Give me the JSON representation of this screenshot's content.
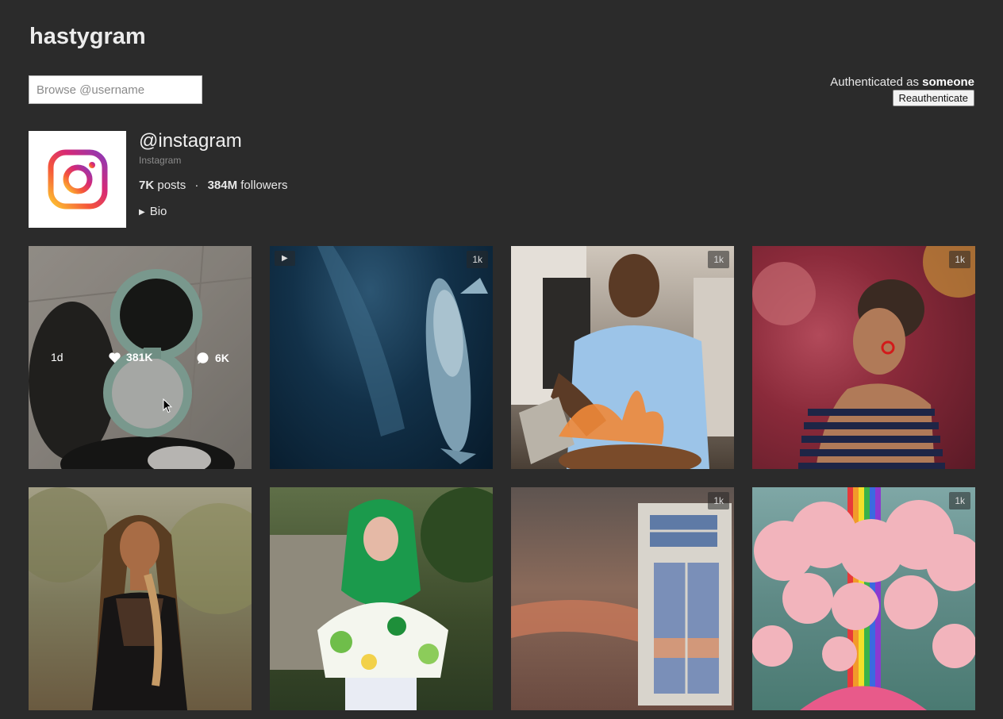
{
  "header": {
    "site_title": "hastygram"
  },
  "search": {
    "placeholder": "Browse @username",
    "value": ""
  },
  "auth": {
    "prefix": "Authenticated as",
    "user": "someone",
    "button_label": "Reauthenticate"
  },
  "profile": {
    "handle": "@instagram",
    "full_name": "Instagram",
    "posts_count": "7K",
    "posts_label": "posts",
    "separator": "·",
    "followers_count": "384M",
    "followers_label": "followers",
    "bio_label": "Bio",
    "avatar_icon": "instagram-logo-icon"
  },
  "posts": [
    {
      "alt": "cat in compact mirror",
      "age": "1d",
      "likes": "381K",
      "comments": "6K",
      "hovered": true
    },
    {
      "alt": "whale underwater",
      "badge_left": "▶",
      "badge_right": "1k"
    },
    {
      "alt": "man flambéing food",
      "badge_right": "1k"
    },
    {
      "alt": "woman in striped top",
      "badge_right": "1k"
    },
    {
      "alt": "woman with braids",
      "badge_right": ""
    },
    {
      "alt": "woman in green hijab",
      "badge_right": ""
    },
    {
      "alt": "sunset through window",
      "badge_right": "1k"
    },
    {
      "alt": "pink clouds rainbow",
      "badge_right": "1k"
    }
  ],
  "colors": {
    "background": "#2b2b2b",
    "text": "#e8e8e8",
    "muted": "#8c8c8c"
  }
}
